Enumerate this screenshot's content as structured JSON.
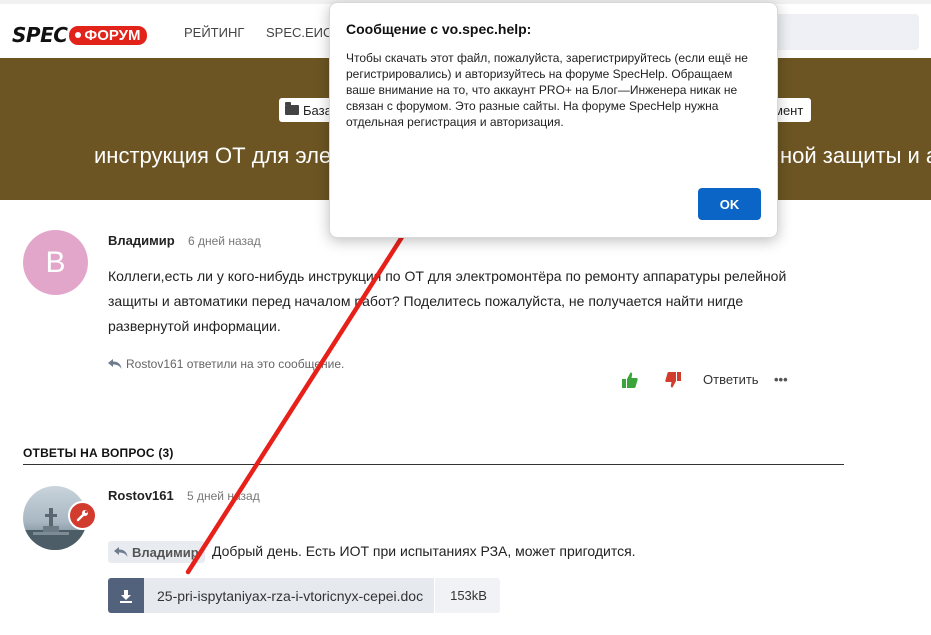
{
  "header": {
    "logo_spec": "SPEC",
    "logo_forum": "ФОРУМ",
    "nav": [
      "РЕЙТИНГ",
      "SPEC.ЕИСО"
    ]
  },
  "banner": {
    "crumb_left": "База",
    "crumb_right": "мент",
    "title_left": "инструкция ОТ для эле",
    "title_right": "ной защиты и ав",
    "bg_color": "#6c5523"
  },
  "post": {
    "avatar_letter": "В",
    "author": "Владимир",
    "time": "6 дней назад",
    "text": "Коллеги,есть ли у кого-нибудь инструкция по ОТ для электромонтёра по ремонту аппаратуры релейной защиты и автоматики перед началом работ? Поделитесь пожалуйста, не получается найти нигде развернутой информации.",
    "replied": "Rostov161 ответили на это сообщение.",
    "reply_label": "Ответить",
    "more": "•••"
  },
  "answers": {
    "title": "ОТВЕТЫ НА ВОПРОС (3)",
    "items": [
      {
        "author": "Rostov161",
        "time": "5 дней назад",
        "quote": "Владимир",
        "text": "Добрый день. Есть ИОТ при испытаниях РЗА, может пригодится.",
        "attachment_name": "25-pri-ispytaniyax-rza-i-vtoricnyx-cepei.doc",
        "attachment_size": "153kB"
      }
    ]
  },
  "dialog": {
    "title": "Сообщение с vo.spec.help:",
    "body": "Чтобы скачать этот файл, пожалуйста, зарегистрируйтесь (если ещё не регистрировались) и авторизуйтесь на форуме SpecHelp. Обращаем ваше внимание на то, что аккаунт PRO+ на Блог—Инженера никак не связан с форумом. Это разные сайты. На форуме SpecHelp нужна отдельная регистрация и авторизация.",
    "ok_label": "OK",
    "ok_color": "#0b65c6"
  },
  "annotation": {
    "arrow_color": "#e8201a"
  },
  "icons": [
    "folder-icon",
    "reply-arrow-icon",
    "thumbs-up-icon",
    "thumbs-down-icon",
    "download-icon",
    "wrench-icon"
  ]
}
